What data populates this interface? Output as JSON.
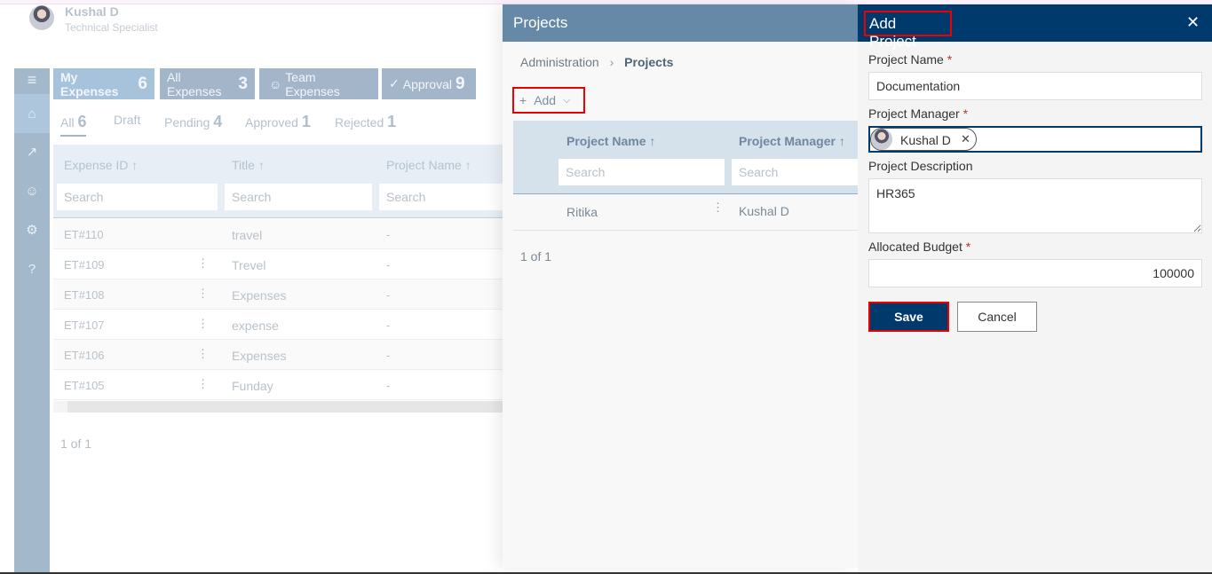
{
  "user": {
    "name": "Kushal D",
    "role": "Technical Specialist"
  },
  "sidebar": {
    "items": [
      {
        "icon": "menu-icon"
      },
      {
        "icon": "home-icon"
      },
      {
        "icon": "chart-icon"
      },
      {
        "icon": "user-settings-icon"
      },
      {
        "icon": "gear-icon"
      },
      {
        "icon": "help-icon"
      }
    ]
  },
  "tabs": [
    {
      "label": "My Expenses",
      "count": "6"
    },
    {
      "label": "All Expenses",
      "count": "3"
    },
    {
      "label": "Team Expenses",
      "count": ""
    },
    {
      "label": "Approval",
      "count": "9"
    }
  ],
  "subtabs": [
    {
      "label": "All",
      "count": "6"
    },
    {
      "label": "Draft",
      "count": ""
    },
    {
      "label": "Pending",
      "count": "4"
    },
    {
      "label": "Approved",
      "count": "1"
    },
    {
      "label": "Rejected",
      "count": "1"
    }
  ],
  "expenses": {
    "columns": [
      "Expense ID ↑",
      "Title ↑",
      "Project Name ↑"
    ],
    "search_placeholder": "Search",
    "rows": [
      [
        "ET#110",
        "travel",
        "-"
      ],
      [
        "ET#109",
        "Trevel",
        "-"
      ],
      [
        "ET#108",
        "Expenses",
        "-"
      ],
      [
        "ET#107",
        "expense",
        "-"
      ],
      [
        "ET#106",
        "Expenses",
        "-"
      ],
      [
        "ET#105",
        "Funday",
        "-"
      ]
    ],
    "pagination": "1 of 1"
  },
  "projects": {
    "title": "Projects",
    "breadcrumb": [
      "Administration",
      "Projects"
    ],
    "add_label": "Add",
    "columns": [
      "Project Name ↑",
      "Project Manager ↑"
    ],
    "search_placeholder": "Search",
    "rows": [
      [
        "Ritika",
        "Kushal D"
      ]
    ],
    "pagination": "1 of 1"
  },
  "form": {
    "title": "Add Project",
    "fields": {
      "name_label": "Project Name",
      "name_value": "Documentation",
      "manager_label": "Project Manager",
      "manager_value": "Kushal D",
      "desc_label": "Project Description",
      "desc_value": "HR365",
      "budget_label": "Allocated Budget",
      "budget_value": "100000"
    },
    "required_mark": "*",
    "save": "Save",
    "cancel": "Cancel"
  },
  "colors": {
    "sidebar": "#a3b8cb",
    "projects_header": "#6589a7",
    "form_header": "#003a6c",
    "highlight": "#e00000"
  }
}
